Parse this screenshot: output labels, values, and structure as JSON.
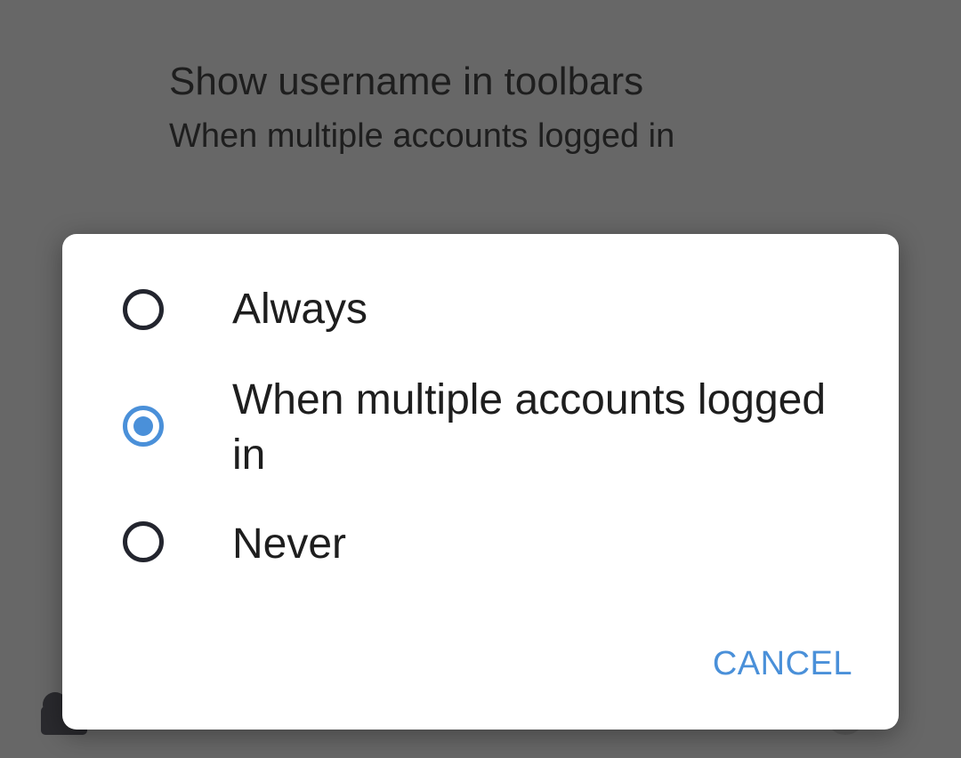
{
  "background": {
    "setting_title": "Show username in toolbars",
    "setting_summary": "When multiple accounts logged in"
  },
  "dialog": {
    "options": [
      {
        "label": "Always",
        "selected": false
      },
      {
        "label": "When multiple accounts logged in",
        "selected": true
      },
      {
        "label": "Never",
        "selected": false
      }
    ],
    "cancel_label": "CANCEL"
  },
  "colors": {
    "accent": "#4a90d9",
    "scrim": "#676767",
    "radio_unchecked": "#23252e",
    "text": "#1e1e1e"
  },
  "icons": [
    "radio-unchecked-icon",
    "radio-checked-icon",
    "radio-unchecked-icon"
  ]
}
